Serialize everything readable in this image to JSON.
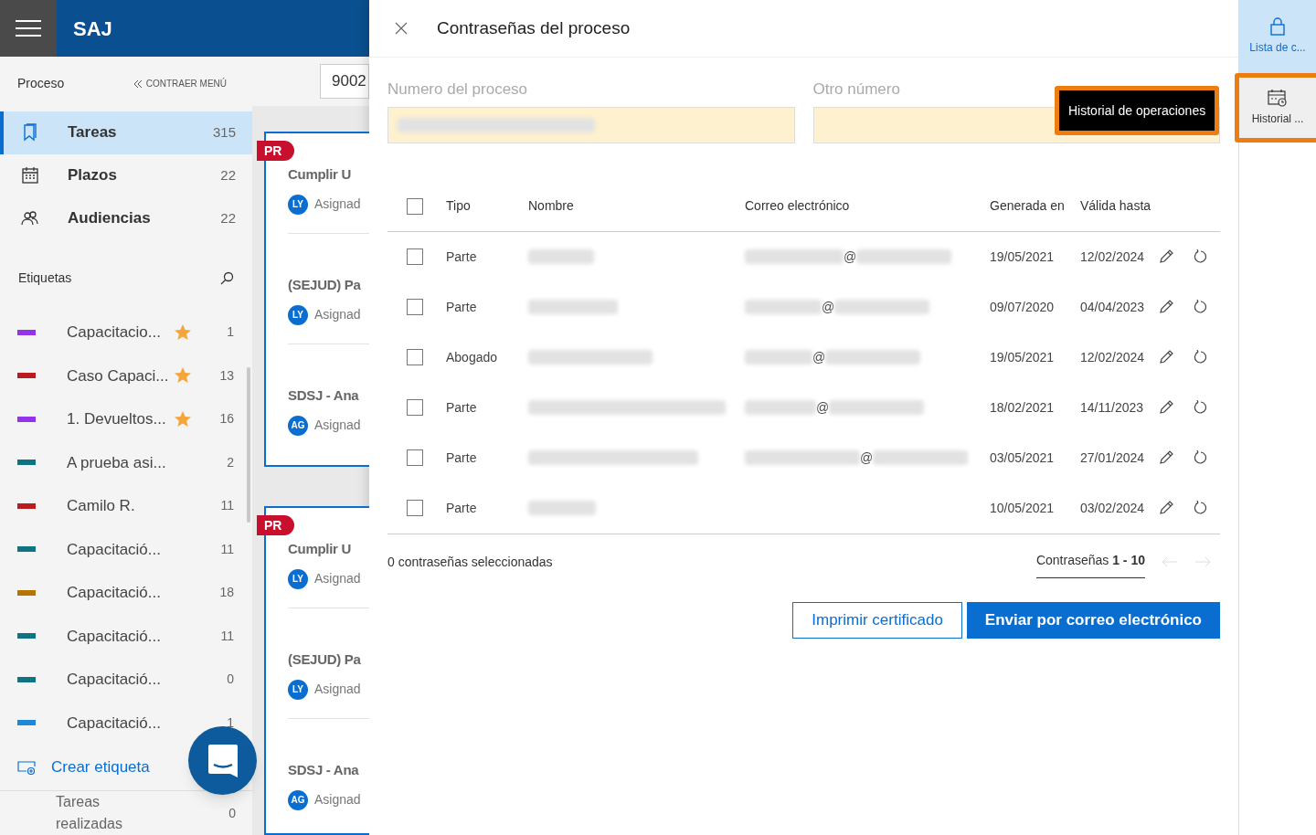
{
  "app": {
    "title": "SAJ"
  },
  "sidebar": {
    "section": "Proceso",
    "collapse": "CONTRAER MENÚ",
    "nav": [
      {
        "kind": "bookmark",
        "label": "Tareas",
        "count": "315",
        "selected": true
      },
      {
        "kind": "calendar",
        "label": "Plazos",
        "count": "22",
        "selected": false
      },
      {
        "kind": "people",
        "label": "Audiencias",
        "count": "22",
        "selected": false
      }
    ],
    "tags_title": "Etiquetas",
    "tags": [
      {
        "label": "Capacitacio...",
        "count": "1",
        "color": "#9333ea",
        "starred": true
      },
      {
        "label": "Caso Capaci...",
        "count": "13",
        "color": "#b91c1c",
        "starred": true
      },
      {
        "label": "1. Devueltos...",
        "count": "16",
        "color": "#9333ea",
        "starred": true
      },
      {
        "label": "A prueba asi...",
        "count": "2",
        "color": "#0e7482",
        "starred": false
      },
      {
        "label": "Camilo R.",
        "count": "11",
        "color": "#b91c1c",
        "starred": false
      },
      {
        "label": "Capacitació...",
        "count": "11",
        "color": "#0e7482",
        "starred": false
      },
      {
        "label": "Capacitació...",
        "count": "18",
        "color": "#b87400",
        "starred": false
      },
      {
        "label": "Capacitació...",
        "count": "11",
        "color": "#0e7482",
        "starred": false
      },
      {
        "label": "Capacitació...",
        "count": "0",
        "color": "#0e7482",
        "starred": false
      },
      {
        "label": "Capacitació...",
        "count": "1",
        "color": "#1e88d6",
        "starred": false
      }
    ],
    "create_tag": "Crear etiqueta",
    "done": {
      "label": "Tareas realizadas",
      "count": "0"
    }
  },
  "search": {
    "value": "9002"
  },
  "cards": [
    {
      "badge": "PR",
      "items": [
        {
          "title": "Cumplir U",
          "avatar": "LY",
          "assignee": "Asignad"
        },
        {
          "title": "(SEJUD) Pa",
          "avatar": "LY",
          "assignee": "Asignad"
        },
        {
          "title": "SDSJ - Ana",
          "avatar": "AG",
          "assignee": "Asignad"
        }
      ]
    },
    {
      "badge": "PR",
      "items": [
        {
          "title": "Cumplir U",
          "avatar": "LY",
          "assignee": "Asignad"
        },
        {
          "title": "(SEJUD) Pa",
          "avatar": "LY",
          "assignee": "Asignad"
        },
        {
          "title": "SDSJ - Ana",
          "avatar": "AG",
          "assignee": "Asignad"
        }
      ]
    }
  ],
  "panel": {
    "title": "Contraseñas del proceso",
    "fields": [
      {
        "label": "Numero del proceso",
        "redacted": true
      },
      {
        "label": "Otro número",
        "redacted": false
      }
    ],
    "all_selected": false,
    "columns": [
      "Tipo",
      "Nombre",
      "Correo electrónico",
      "Generada en",
      "Válida hasta"
    ],
    "rows": [
      {
        "selected": false,
        "tipo": "Parte",
        "email_at": "@",
        "generada": "19/05/2021",
        "valida": "12/02/2024"
      },
      {
        "selected": false,
        "tipo": "Parte",
        "email_at": "@",
        "generada": "09/07/2020",
        "valida": "04/04/2023"
      },
      {
        "selected": false,
        "tipo": "Abogado",
        "email_at": "@",
        "generada": "19/05/2021",
        "valida": "12/02/2024"
      },
      {
        "selected": false,
        "tipo": "Parte",
        "email_at": "@",
        "generada": "18/02/2021",
        "valida": "14/11/2023"
      },
      {
        "selected": false,
        "tipo": "Parte",
        "email_at": "@",
        "generada": "03/05/2021",
        "valida": "27/01/2024"
      },
      {
        "selected": false,
        "tipo": "Parte",
        "generada": "10/05/2021",
        "valida": "03/02/2024"
      }
    ],
    "summary": "0 contraseñas seleccionadas",
    "pagination": "Contraseñas **1 - 10**",
    "buttons": [
      {
        "kind": "outline",
        "label": "Imprimir certificado"
      },
      {
        "kind": "primary",
        "label": "Enviar por correo electrónico"
      }
    ]
  },
  "rail": [
    {
      "kind": "lock",
      "label": "Lista de c...",
      "selected": true,
      "highlighted": false
    },
    {
      "kind": "history",
      "label": "Historial ...",
      "selected": false,
      "highlighted": true
    }
  ],
  "tooltip": "Historial de operaciones"
}
